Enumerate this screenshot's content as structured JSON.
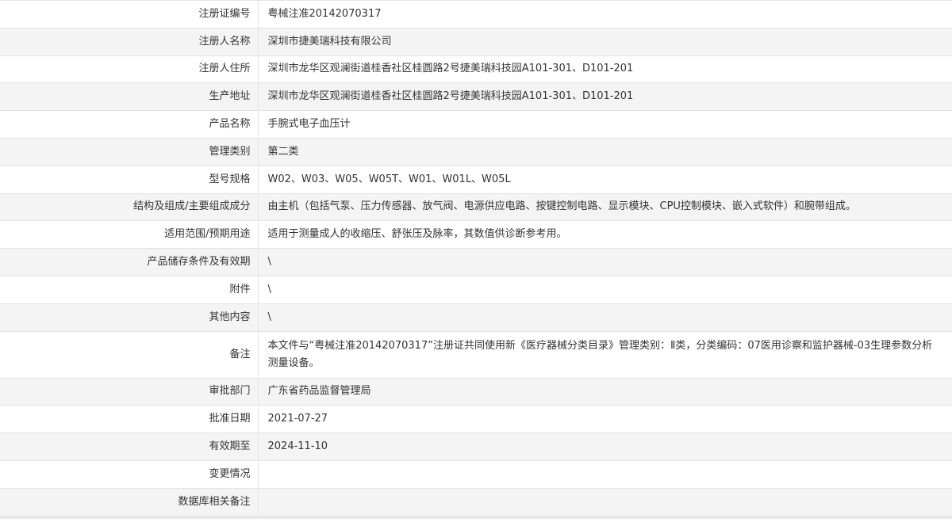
{
  "record": {
    "rows": [
      {
        "label": "注册证编号",
        "value": "粤械注准20142070317"
      },
      {
        "label": "注册人名称",
        "value": "深圳市捷美瑞科技有限公司"
      },
      {
        "label": "注册人住所",
        "value": "深圳市龙华区观澜街道桂香社区桂圆路2号捷美瑞科技园A101-301、D101-201"
      },
      {
        "label": "生产地址",
        "value": "深圳市龙华区观澜街道桂香社区桂圆路2号捷美瑞科技园A101-301、D101-201"
      },
      {
        "label": "产品名称",
        "value": "手腕式电子血压计"
      },
      {
        "label": "管理类别",
        "value": "第二类"
      },
      {
        "label": "型号规格",
        "value": "W02、W03、W05、W05T、W01、W01L、W05L"
      },
      {
        "label": "结构及组成/主要组成成分",
        "value": "由主机（包括气泵、压力传感器、放气阀、电源供应电路、按键控制电路、显示模块、CPU控制模块、嵌入式软件）和腕带组成。"
      },
      {
        "label": "适用范围/预期用途",
        "value": "适用于测量成人的收缩压、舒张压及脉率，其数值供诊断参考用。"
      },
      {
        "label": "产品储存条件及有效期",
        "value": "\\"
      },
      {
        "label": "附件",
        "value": "\\"
      },
      {
        "label": "其他内容",
        "value": "\\"
      },
      {
        "label": "备注",
        "value": "本文件与“粤械注准20142070317”注册证共同使用新《医疗器械分类目录》管理类别：Ⅱ类，分类编码：07医用诊察和监护器械-03生理参数分析测量设备。"
      },
      {
        "label": "审批部门",
        "value": "广东省药品监督管理局"
      },
      {
        "label": "批准日期",
        "value": "2021-07-27"
      },
      {
        "label": "有效期至",
        "value": "2024-11-10"
      },
      {
        "label": "变更情况",
        "value": ""
      },
      {
        "label": "数据库相关备注",
        "value": ""
      }
    ]
  }
}
